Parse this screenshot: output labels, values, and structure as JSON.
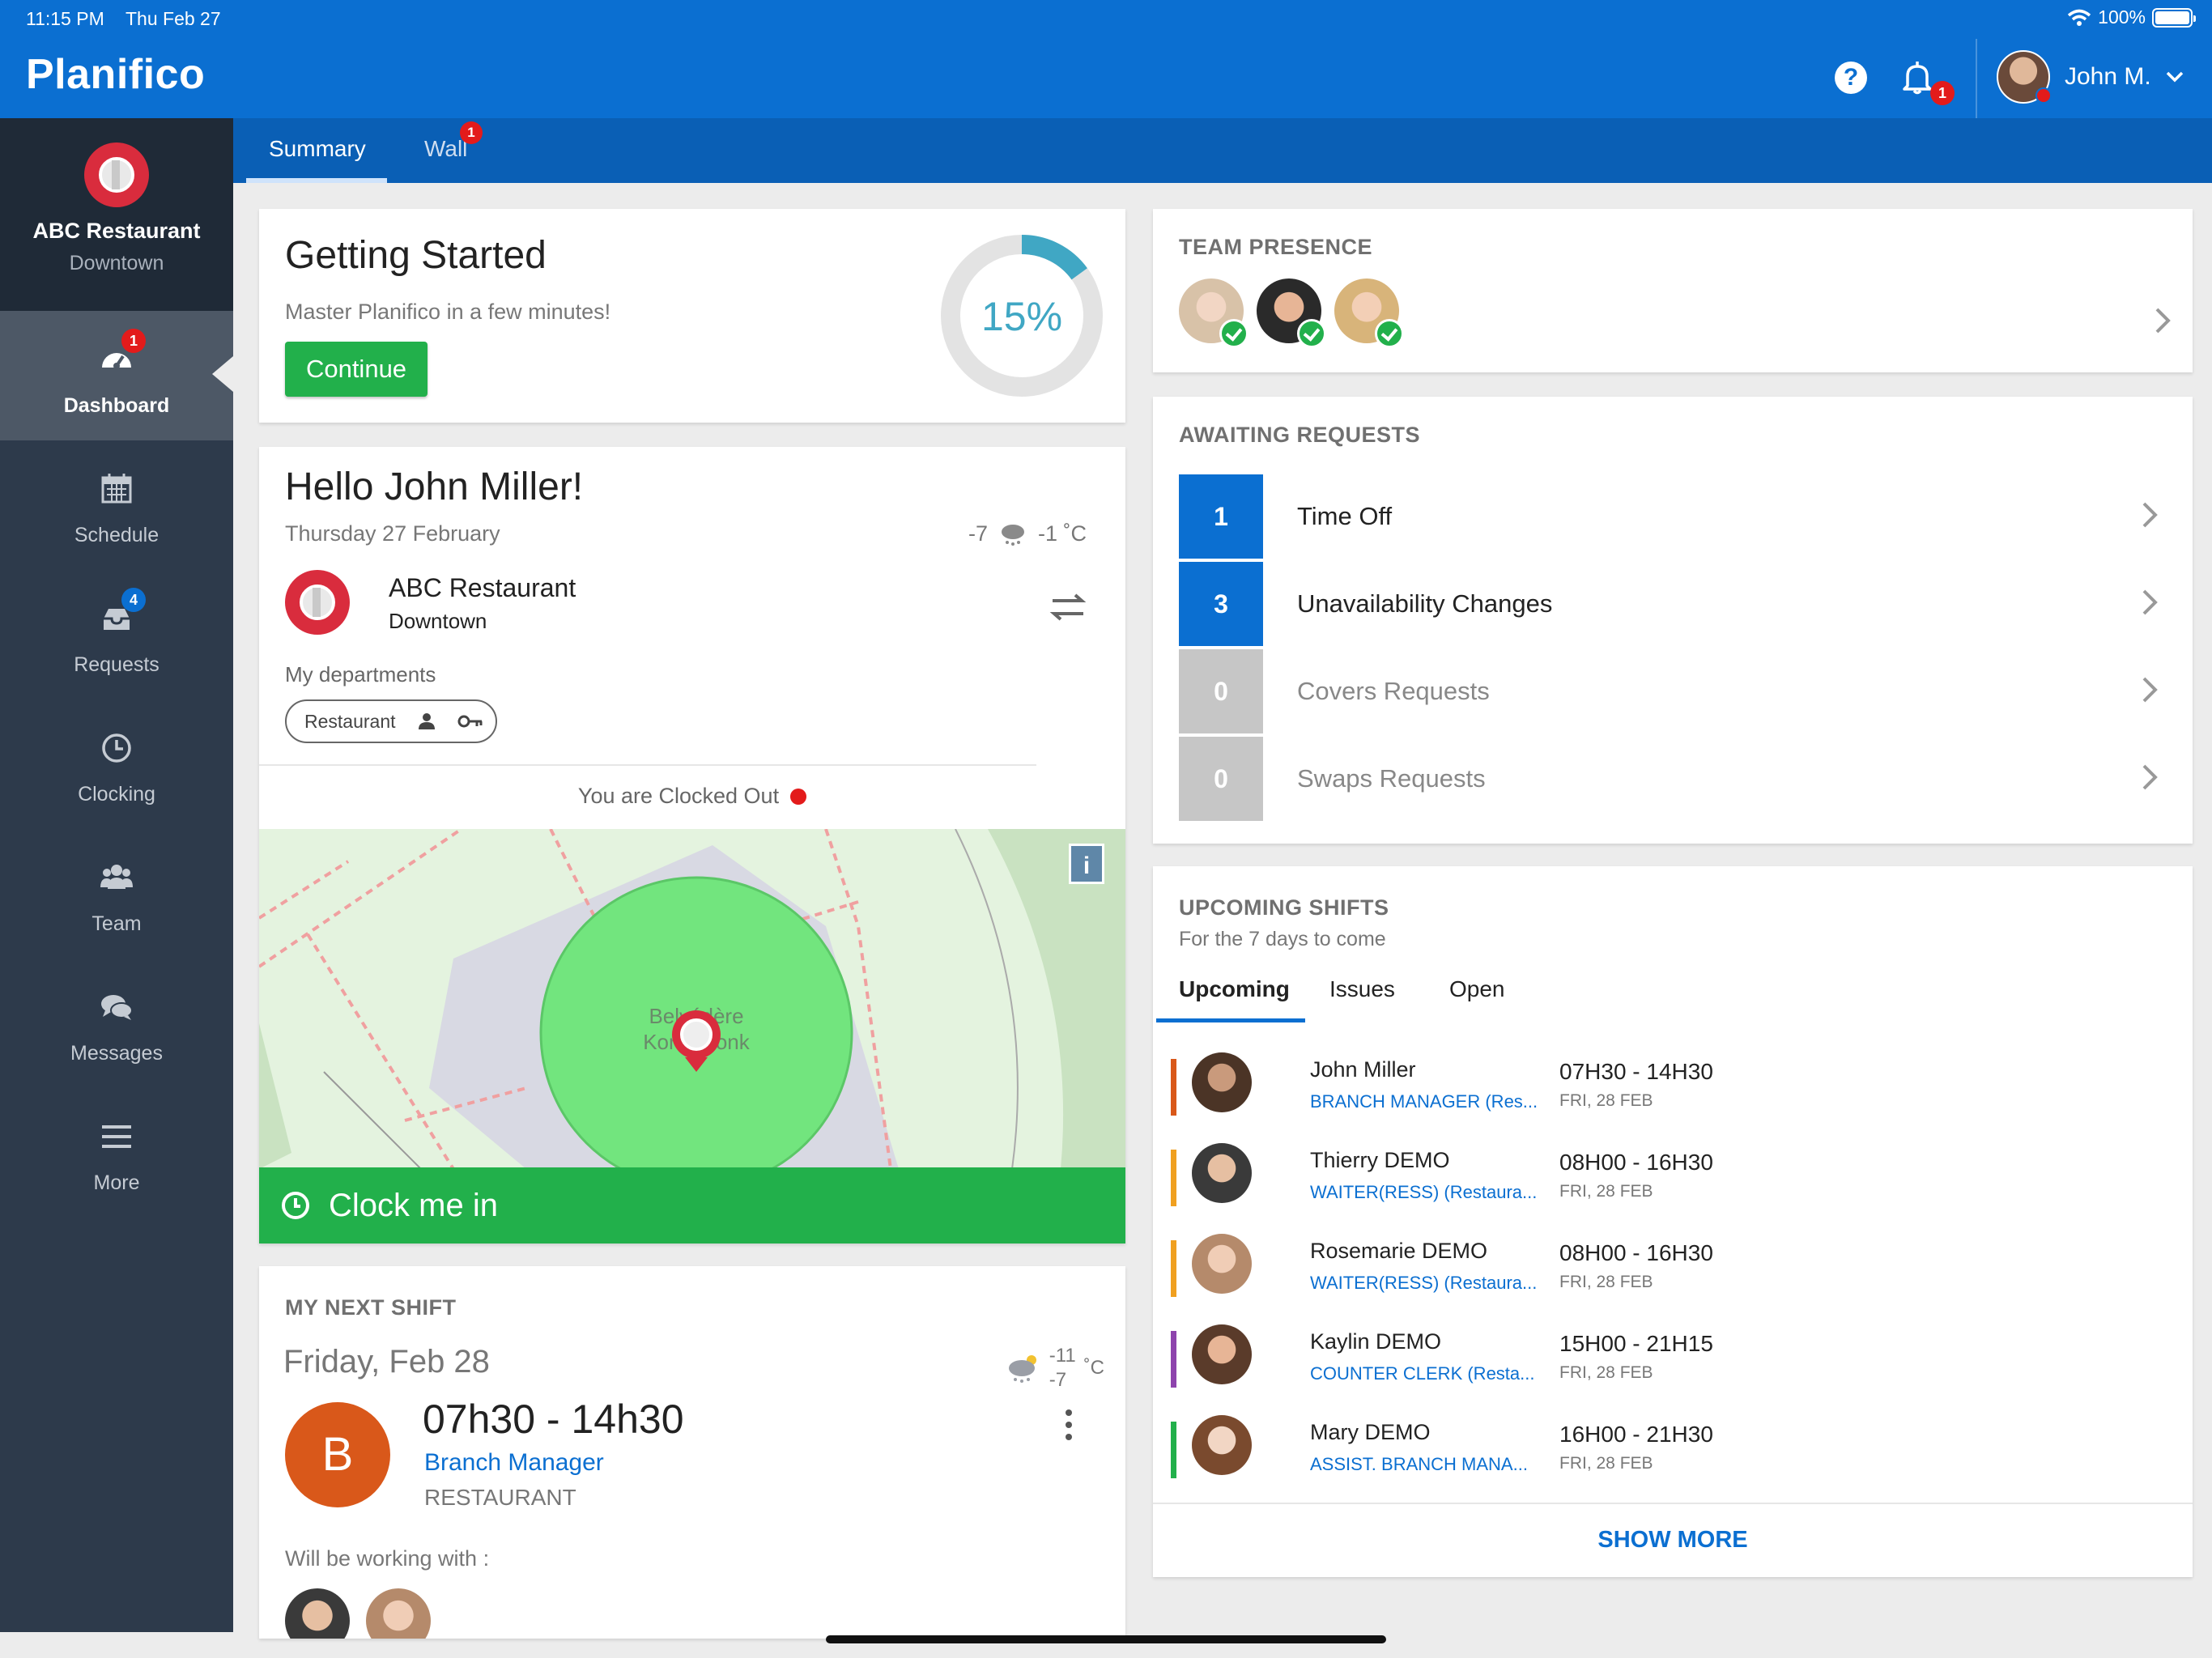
{
  "status_bar": {
    "time": "11:15 PM",
    "date": "Thu Feb 27",
    "battery": "100%"
  },
  "header": {
    "logo": "Planifico",
    "notification_count": "1",
    "user_name": "John M."
  },
  "sidebar": {
    "store_name": "ABC Restaurant",
    "store_sub": "Downtown",
    "items": [
      {
        "label": "Dashboard",
        "icon": "dashboard-icon",
        "badge": "1"
      },
      {
        "label": "Schedule",
        "icon": "calendar-icon"
      },
      {
        "label": "Requests",
        "icon": "inbox-icon",
        "badge": "4"
      },
      {
        "label": "Clocking",
        "icon": "clock-icon"
      },
      {
        "label": "Team",
        "icon": "team-icon"
      },
      {
        "label": "Messages",
        "icon": "chat-icon"
      },
      {
        "label": "More",
        "icon": "menu-icon"
      }
    ]
  },
  "tabs": {
    "summary": "Summary",
    "wall": "Wall",
    "wall_badge": "1"
  },
  "getting_started": {
    "title": "Getting Started",
    "subtitle": "Master Planifico in a few minutes!",
    "button": "Continue",
    "progress_label": "15%",
    "progress": 0.15
  },
  "hello": {
    "title": "Hello John Miller!",
    "date": "Thursday 27 February",
    "temp_low": "-7",
    "temp_high": "-1 ˚C",
    "restaurant_name": "ABC Restaurant",
    "restaurant_sub": "Downtown",
    "departments_label": "My departments",
    "department": "Restaurant",
    "clock_status": "You are Clocked Out",
    "map_label_1": "Belvédère",
    "map_label_2": "Kondiaronk",
    "map_info": "i",
    "clock_in_button": "Clock me in"
  },
  "next_shift": {
    "title": "MY NEXT SHIFT",
    "day": "Friday, Feb 28",
    "temp_1": "-11",
    "temp_2": "-7",
    "temp_unit": "˚C",
    "badge_letter": "B",
    "time": "07h30 - 14h30",
    "role": "Branch Manager",
    "department": "RESTAURANT",
    "working_with": "Will be working with :"
  },
  "team_presence": {
    "title": "TEAM PRESENCE"
  },
  "awaiting_requests": {
    "title": "AWAITING REQUESTS",
    "items": [
      {
        "count": "1",
        "label": "Time Off"
      },
      {
        "count": "3",
        "label": "Unavailability Changes"
      },
      {
        "count": "0",
        "label": "Covers Requests"
      },
      {
        "count": "0",
        "label": "Swaps Requests"
      }
    ]
  },
  "upcoming_shifts": {
    "title": "UPCOMING SHIFTS",
    "subtitle": "For the 7 days to come",
    "tabs": [
      "Upcoming",
      "Issues",
      "Open"
    ],
    "rows": [
      {
        "name": "John Miller",
        "role": "BRANCH MANAGER (Res...",
        "time": "07H30 - 14H30",
        "date": "FRI, 28 FEB",
        "color": "#d9581a"
      },
      {
        "name": "Thierry DEMO",
        "role": "WAITER(RESS) (Restaura...",
        "time": "08H00 - 16H30",
        "date": "FRI, 28 FEB",
        "color": "#f0a020"
      },
      {
        "name": "Rosemarie DEMO",
        "role": "WAITER(RESS) (Restaura...",
        "time": "08H00 - 16H30",
        "date": "FRI, 28 FEB",
        "color": "#f0a020"
      },
      {
        "name": "Kaylin DEMO",
        "role": "COUNTER CLERK (Resta...",
        "time": "15H00 - 21H15",
        "date": "FRI, 28 FEB",
        "color": "#8e44ad"
      },
      {
        "name": "Mary DEMO",
        "role": "ASSIST. BRANCH MANA...",
        "time": "16H00 - 21H30",
        "date": "FRI, 28 FEB",
        "color": "#22b04b"
      }
    ],
    "show_more": "SHOW MORE"
  },
  "colors": {
    "primary": "#0b6fd1",
    "sidebar": "#2d3a4b",
    "success": "#22b04b",
    "danger": "#e31b1b"
  }
}
